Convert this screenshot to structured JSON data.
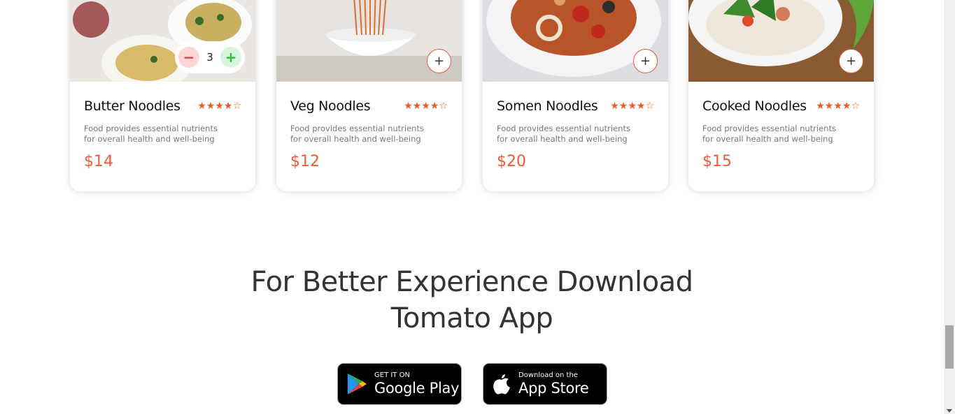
{
  "food_items": [
    {
      "name": "Butter Noodles",
      "rating": 4,
      "stars_text": "★★★★☆",
      "description": "Food provides essential nutrients for overall health and well-being",
      "price": "$14",
      "in_cart_count": "3"
    },
    {
      "name": "Veg Noodles",
      "rating": 4,
      "stars_text": "★★★★☆",
      "description": "Food provides essential nutrients for overall health and well-being",
      "price": "$12",
      "add_label": "+"
    },
    {
      "name": "Somen Noodles",
      "rating": 4,
      "stars_text": "★★★★☆",
      "description": "Food provides essential nutrients for overall health and well-being",
      "price": "$20",
      "add_label": "+"
    },
    {
      "name": "Cooked Noodles",
      "rating": 4,
      "stars_text": "★★★★☆",
      "description": "Food provides essential nutrients for overall health and well-being",
      "price": "$15",
      "add_label": "+"
    }
  ],
  "counter": {
    "minus": "−",
    "plus": "+"
  },
  "app_download": {
    "heading_line1": "For Better Experience Download",
    "heading_line2": "Tomato App",
    "google_play": {
      "small": "GET IT ON",
      "big": "Google Play"
    },
    "app_store": {
      "small": "Download on the",
      "big": "App Store"
    }
  },
  "colors": {
    "accent": "#ec5b3b",
    "star": "#f05a28"
  }
}
